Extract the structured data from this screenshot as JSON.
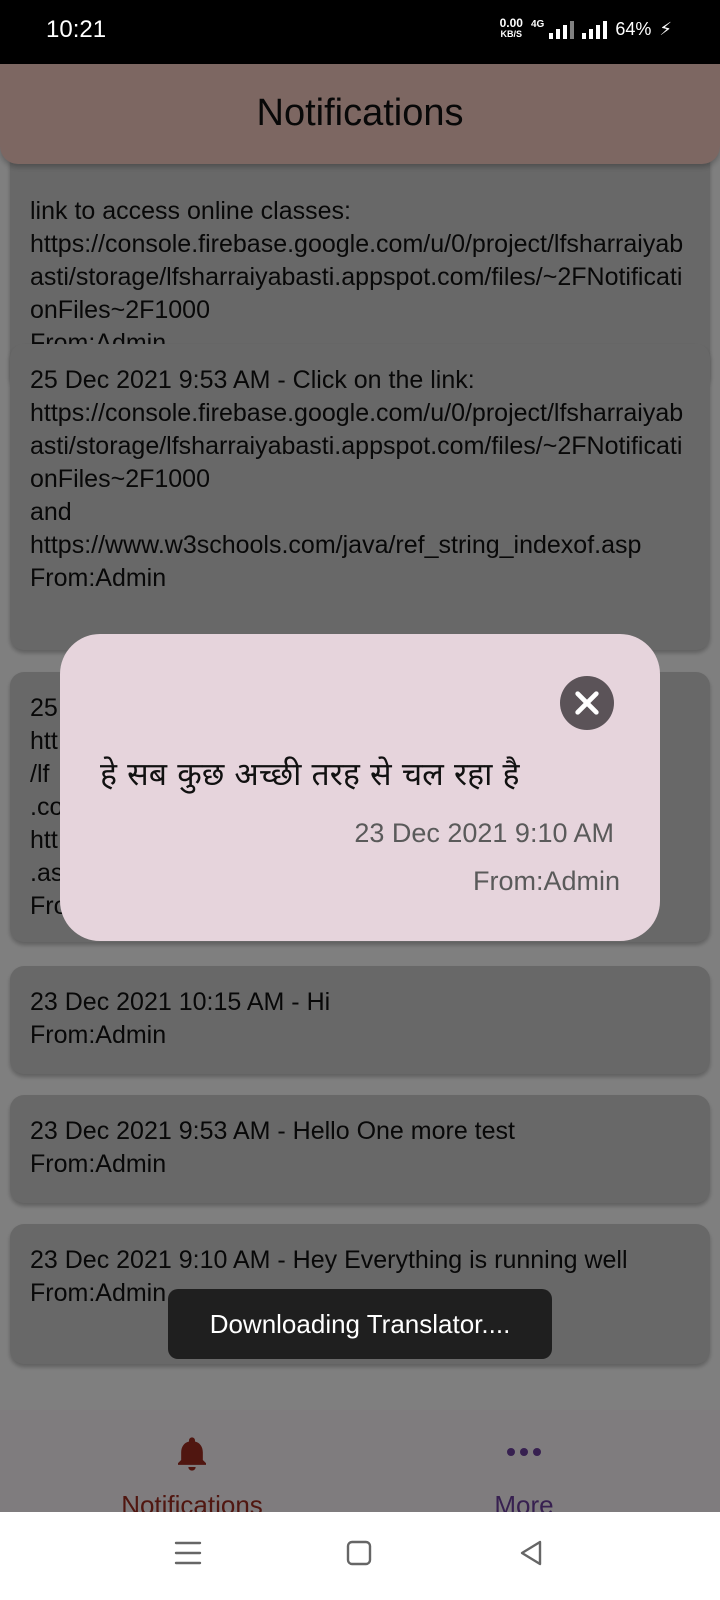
{
  "status_bar": {
    "time": "10:21",
    "net_speed": "0.00",
    "net_unit": "KB/S",
    "network_type": "4G",
    "battery": "64%"
  },
  "header": {
    "title": "Notifications"
  },
  "notifications": [
    {
      "text": "link to access online classes:\nhttps://console.firebase.google.com/u/0/project/lfsharraiyabasti/storage/lfsharraiyabasti.appspot.com/files/~2FNotificationFiles~2F1000\nFrom:Admin"
    },
    {
      "text": "25 Dec 2021 9:53 AM - Click on the link:\nhttps://console.firebase.google.com/u/0/project/lfsharraiyabasti/storage/lfsharraiyabasti.appspot.com/files/~2FNotificationFiles~2F1000\nand\nhttps://www.w3schools.com/java/ref_string_indexof.asp\nFrom:Admin"
    },
    {
      "text": "25\nhtt\n/lf\n.co\nhtt                                                                                              of\n.as\nFro"
    },
    {
      "text": "23 Dec 2021 10:15 AM - Hi\nFrom:Admin"
    },
    {
      "text": "23 Dec 2021 9:53 AM - Hello One more test\nFrom:Admin"
    },
    {
      "text": "23 Dec 2021 9:10 AM - Hey Everything is running well\nFrom:Admin"
    }
  ],
  "dialog": {
    "message": "हे सब कुछ अच्छी तरह से चल रहा है",
    "date": "23 Dec 2021 9:10 AM",
    "from": "From:Admin"
  },
  "toast": {
    "text": "Downloading Translator...."
  },
  "bottom_nav": {
    "notifications_label": "Notifications",
    "more_label": "More"
  },
  "colors": {
    "header": "#f0c5bc",
    "dialog": "#e6d4dc",
    "nav_active": "#9a2b1f",
    "nav_more": "#6a3f9a"
  }
}
